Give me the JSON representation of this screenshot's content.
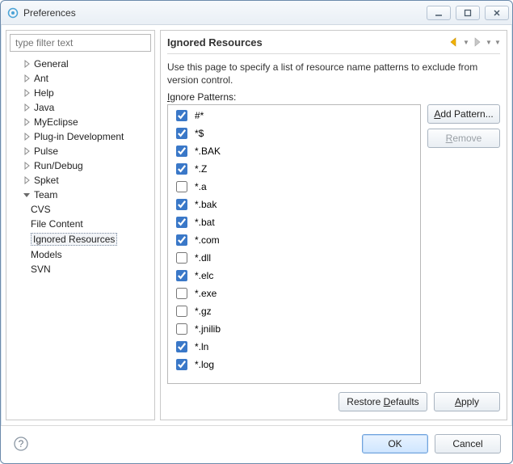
{
  "window": {
    "title": "Preferences"
  },
  "filter": {
    "placeholder": "type filter text"
  },
  "tree": {
    "items": [
      {
        "label": "General",
        "level": "top"
      },
      {
        "label": "Ant",
        "level": "top"
      },
      {
        "label": "Help",
        "level": "top"
      },
      {
        "label": "Java",
        "level": "top"
      },
      {
        "label": "MyEclipse",
        "level": "top"
      },
      {
        "label": "Plug-in Development",
        "level": "top"
      },
      {
        "label": "Pulse",
        "level": "top"
      },
      {
        "label": "Run/Debug",
        "level": "top"
      },
      {
        "label": "Spket",
        "level": "top"
      },
      {
        "label": "Team",
        "level": "top",
        "expanded": true
      },
      {
        "label": "CVS",
        "level": "child"
      },
      {
        "label": "File Content",
        "level": "child"
      },
      {
        "label": "Ignored Resources",
        "level": "child",
        "selected": true
      },
      {
        "label": "Models",
        "level": "child"
      },
      {
        "label": "SVN",
        "level": "child"
      }
    ]
  },
  "page": {
    "title": "Ignored Resources",
    "description": "Use this page to specify a list of resource name patterns to exclude from version control.",
    "patterns_label": "Ignore Patterns:"
  },
  "patterns": [
    {
      "label": "#*",
      "checked": true
    },
    {
      "label": "*$",
      "checked": true
    },
    {
      "label": "*.BAK",
      "checked": true
    },
    {
      "label": "*.Z",
      "checked": true
    },
    {
      "label": "*.a",
      "checked": false
    },
    {
      "label": "*.bak",
      "checked": true
    },
    {
      "label": "*.bat",
      "checked": true
    },
    {
      "label": "*.com",
      "checked": true
    },
    {
      "label": "*.dll",
      "checked": false
    },
    {
      "label": "*.elc",
      "checked": true
    },
    {
      "label": "*.exe",
      "checked": false
    },
    {
      "label": "*.gz",
      "checked": false
    },
    {
      "label": "*.jnilib",
      "checked": false
    },
    {
      "label": "*.ln",
      "checked": true
    },
    {
      "label": "*.log",
      "checked": true
    }
  ],
  "buttons": {
    "add_pattern": "Add Pattern...",
    "remove": "Remove",
    "restore_defaults": "Restore Defaults",
    "apply": "Apply",
    "ok": "OK",
    "cancel": "Cancel"
  },
  "colors": {
    "back_arrow": "#f2b200",
    "fwd_arrow": "#b0b0b0"
  }
}
